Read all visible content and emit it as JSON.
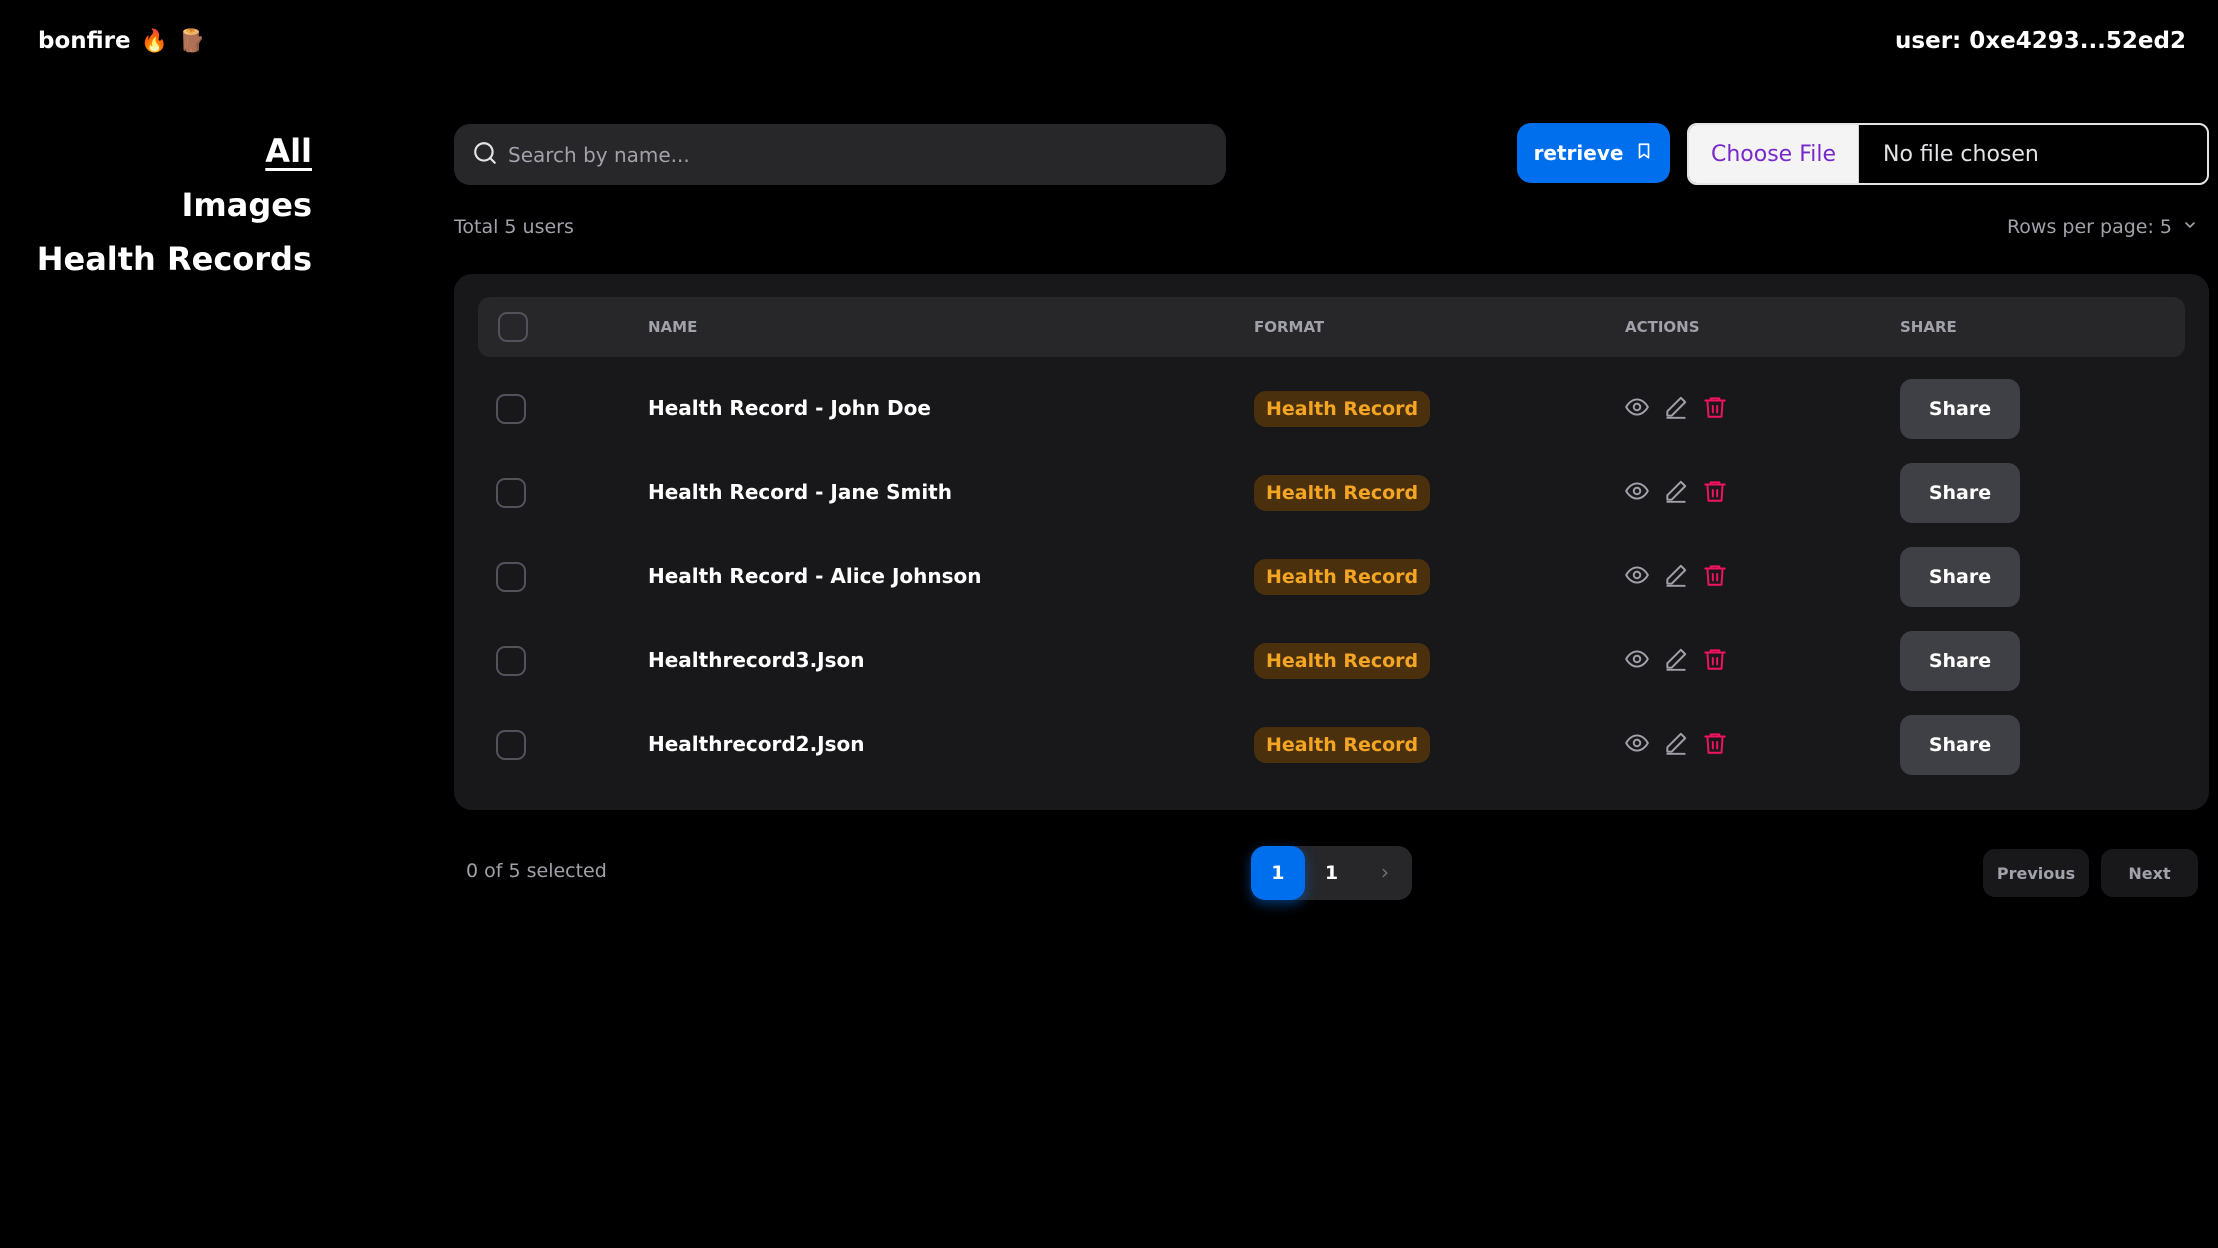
{
  "header": {
    "brand": "bonfire",
    "brand_emoji_1": "🔥",
    "brand_emoji_2": "🪵",
    "user": "user: 0xe4293...52ed2"
  },
  "sidebar": {
    "items": [
      {
        "label": "All",
        "active": true
      },
      {
        "label": "Images",
        "active": false
      },
      {
        "label": "Health Records",
        "active": false
      }
    ]
  },
  "toolbar": {
    "search_placeholder": "Search by name...",
    "retrieve_label": "retrieve",
    "file_choose_label": "Choose File",
    "file_status": "No file chosen"
  },
  "summary": {
    "total_users": "Total 5 users",
    "rows_per_page": "Rows per page: 5"
  },
  "table": {
    "headers": {
      "name": "NAME",
      "format": "FORMAT",
      "actions": "ACTIONS",
      "share": "SHARE"
    },
    "rows": [
      {
        "name": "Health Record - John Doe",
        "format": "Health Record",
        "share": "Share"
      },
      {
        "name": "Health Record - Jane Smith",
        "format": "Health Record",
        "share": "Share"
      },
      {
        "name": "Health Record - Alice Johnson",
        "format": "Health Record",
        "share": "Share"
      },
      {
        "name": "Healthrecord3.Json",
        "format": "Health Record",
        "share": "Share"
      },
      {
        "name": "Healthrecord2.Json",
        "format": "Health Record",
        "share": "Share"
      }
    ]
  },
  "footer": {
    "selected": "0 of 5 selected",
    "page_current": "1",
    "page_other": "1",
    "previous": "Previous",
    "next": "Next"
  },
  "colors": {
    "primary": "#006FEE",
    "warning": "#f5a524",
    "danger": "#f31260",
    "secondary": "#7828C8"
  },
  "icons": {
    "search": "search-icon",
    "retrieve": "bookmark-icon",
    "view": "eye-icon",
    "edit": "pencil-icon",
    "delete": "trash-icon",
    "dropdown": "chevron-down-icon",
    "next_page": "chevron-right-icon"
  }
}
